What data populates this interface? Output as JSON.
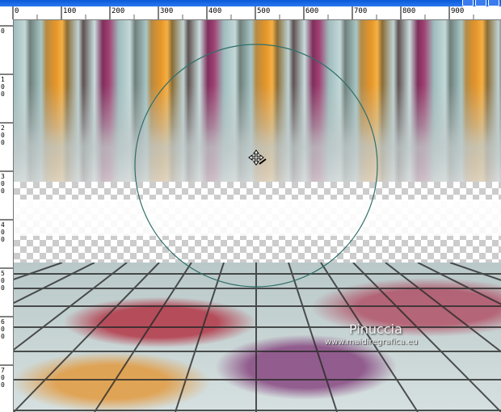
{
  "ruler": {
    "top_labels": [
      {
        "text": "0"
      },
      {
        "text": "100"
      },
      {
        "text": "200"
      },
      {
        "text": "300"
      },
      {
        "text": "400"
      },
      {
        "text": "500"
      },
      {
        "text": "600"
      },
      {
        "text": "700"
      },
      {
        "text": "800"
      },
      {
        "text": "900"
      }
    ],
    "left_labels": [
      {
        "text": "0"
      },
      {
        "text": "1\n0\n0"
      },
      {
        "text": "2\n0\n0"
      },
      {
        "text": "3\n0\n0"
      },
      {
        "text": "4\n0\n0"
      },
      {
        "text": "5\n0\n0"
      },
      {
        "text": "6\n0\n0"
      },
      {
        "text": "7\n0\n0"
      }
    ]
  },
  "watermark": {
    "name": "Pinuccia",
    "url": "www.maidiregrafica.eu"
  },
  "colors": {
    "titlebar": "#0a5bd9",
    "ellipse_stroke": "#2f6f6a"
  },
  "icons": {
    "cursor": "move-cursor-icon"
  }
}
